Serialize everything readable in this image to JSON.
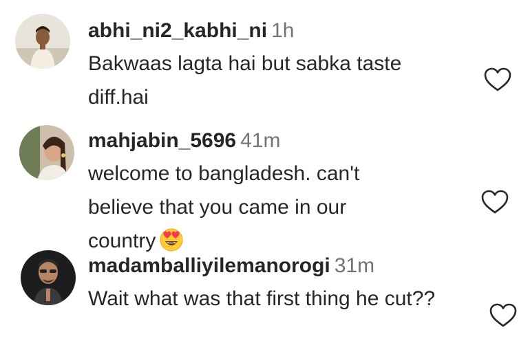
{
  "comments": [
    {
      "username": "abhi_ni2_kabhi_ni",
      "time": "1h",
      "text": "Bakwaas lagta hai but sabka taste diff.hai",
      "emoji": "",
      "avatar_icon": "avatar-man-white-kurta",
      "like_icon": "heart-outline-icon"
    },
    {
      "username": "mahjabin_5696",
      "time": "41m",
      "text": "welcome to bangladesh. can't believe that you came in our country",
      "emoji": "heart-eyes-emoji",
      "avatar_icon": "avatar-woman-portrait",
      "like_icon": "heart-outline-icon"
    },
    {
      "username": "madamballiyilemanorogi",
      "time": "31m",
      "text": "Wait what was that first thing he cut??",
      "emoji": "",
      "avatar_icon": "avatar-man-dark-background",
      "like_icon": "heart-outline-icon"
    }
  ],
  "colors": {
    "username": "#262626",
    "timestamp": "#737373",
    "text": "#262626",
    "heart_outline": "#262626"
  }
}
